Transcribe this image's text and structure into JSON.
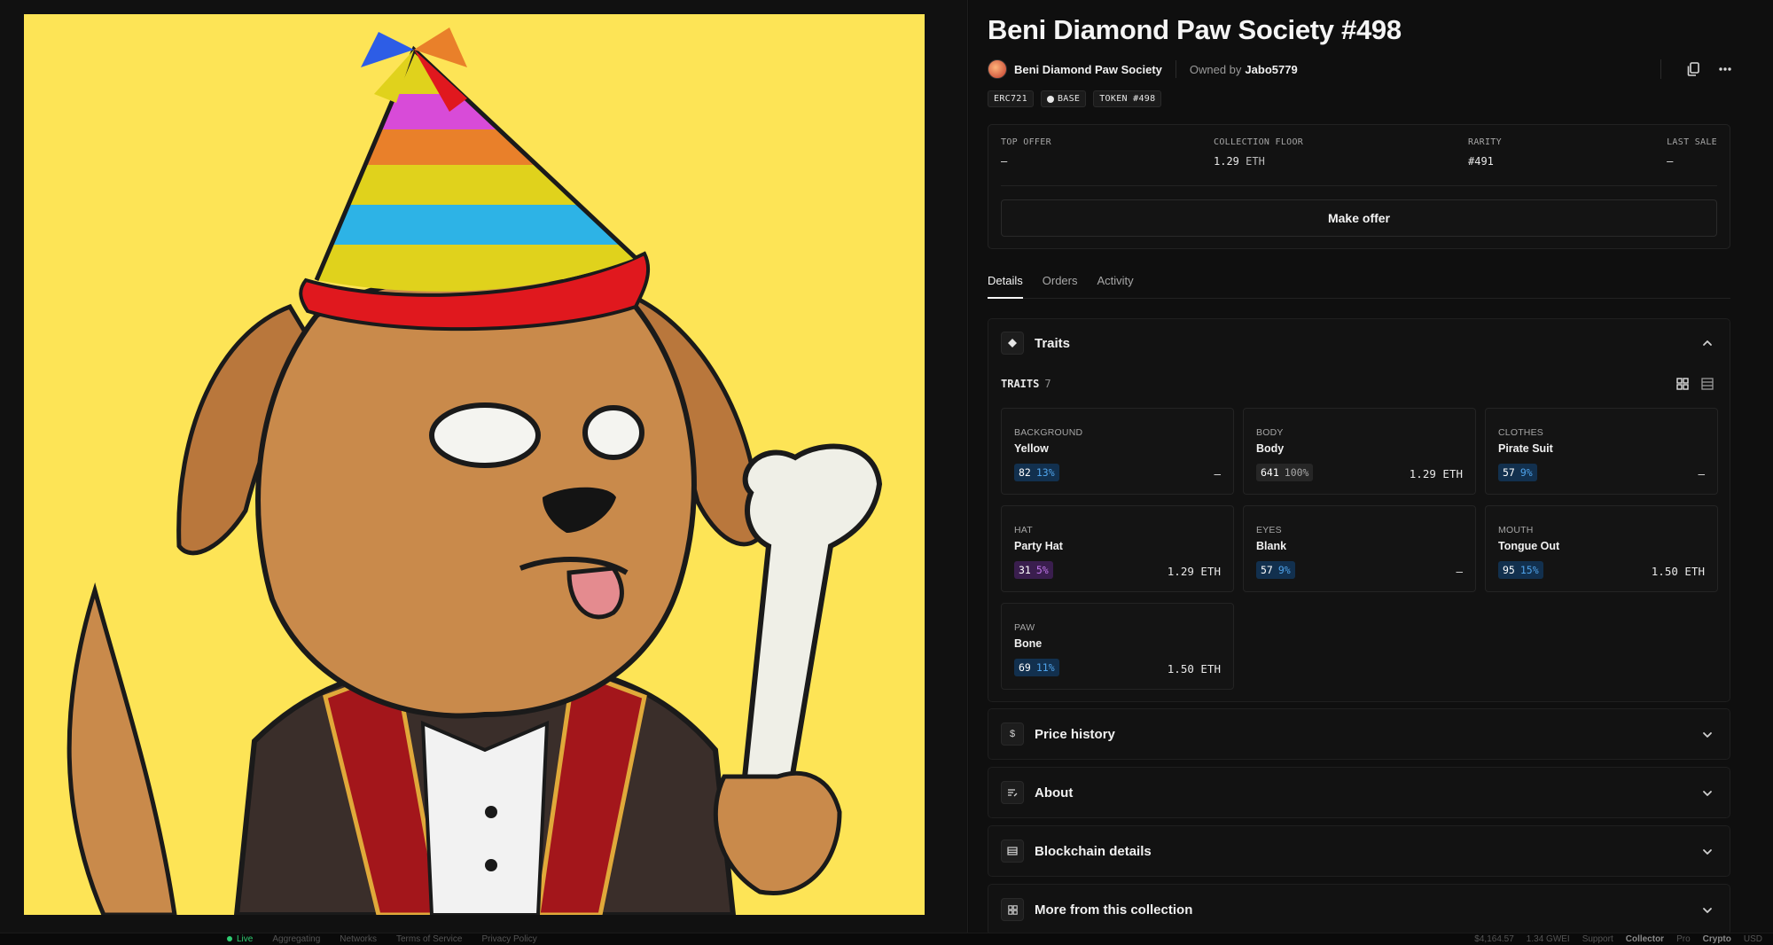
{
  "nft": {
    "title": "Beni Diamond Paw Society #498",
    "collection_name": "Beni Diamond Paw Society",
    "owned_by_label": "Owned by",
    "owner": "Jabo5779",
    "image_alt": "Brown dog wearing a rainbow party hat and pirate suit holding a bone on yellow background",
    "image_background": "#fde456"
  },
  "badges": [
    "ERC721",
    "BASE",
    "TOKEN #498"
  ],
  "stats": {
    "top_offer": {
      "label": "TOP OFFER",
      "value": "–"
    },
    "collection_floor": {
      "label": "COLLECTION FLOOR",
      "value": "1.29",
      "unit": "ETH"
    },
    "rarity": {
      "label": "RARITY",
      "value": "#491"
    },
    "last_sale": {
      "label": "LAST SALE",
      "value": "–"
    }
  },
  "make_offer_label": "Make offer",
  "tabs": [
    {
      "label": "Details",
      "active": true
    },
    {
      "label": "Orders",
      "active": false
    },
    {
      "label": "Activity",
      "active": false
    }
  ],
  "traits_panel": {
    "title": "Traits",
    "count_label": "TRAITS",
    "count": "7",
    "traits": [
      {
        "type": "BACKGROUND",
        "value": "Yellow",
        "count": "82",
        "pct": "13%",
        "price": "–",
        "chip_color": "blue"
      },
      {
        "type": "BODY",
        "value": "Body",
        "count": "641",
        "pct": "100%",
        "price": "1.29 ETH",
        "chip_color": "gray"
      },
      {
        "type": "CLOTHES",
        "value": "Pirate Suit",
        "count": "57",
        "pct": "9%",
        "price": "–",
        "chip_color": "blue"
      },
      {
        "type": "HAT",
        "value": "Party Hat",
        "count": "31",
        "pct": "5%",
        "price": "1.29 ETH",
        "chip_color": "purple"
      },
      {
        "type": "EYES",
        "value": "Blank",
        "count": "57",
        "pct": "9%",
        "price": "–",
        "chip_color": "blue"
      },
      {
        "type": "MOUTH",
        "value": "Tongue Out",
        "count": "95",
        "pct": "15%",
        "price": "1.50 ETH",
        "chip_color": "blue"
      },
      {
        "type": "PAW",
        "value": "Bone",
        "count": "69",
        "pct": "11%",
        "price": "1.50 ETH",
        "chip_color": "blue"
      }
    ]
  },
  "collapsed_panels": [
    {
      "title": "Price history",
      "icon": "dollar-icon"
    },
    {
      "title": "About",
      "icon": "notes-icon"
    },
    {
      "title": "Blockchain details",
      "icon": "table-icon"
    },
    {
      "title": "More from this collection",
      "icon": "grid-icon"
    }
  ],
  "footer": {
    "left": [
      "Live",
      "Aggregating",
      "Networks",
      "Terms of Service",
      "Privacy Policy"
    ],
    "right": [
      "$4,164.57",
      "1.34 GWEI",
      "Support",
      "Collector",
      "Pro",
      "Crypto",
      "USD"
    ]
  },
  "colors": {
    "accent_blue": "#4fa3ea",
    "accent_purple": "#c177ec",
    "live_green": "#2ecc71"
  }
}
